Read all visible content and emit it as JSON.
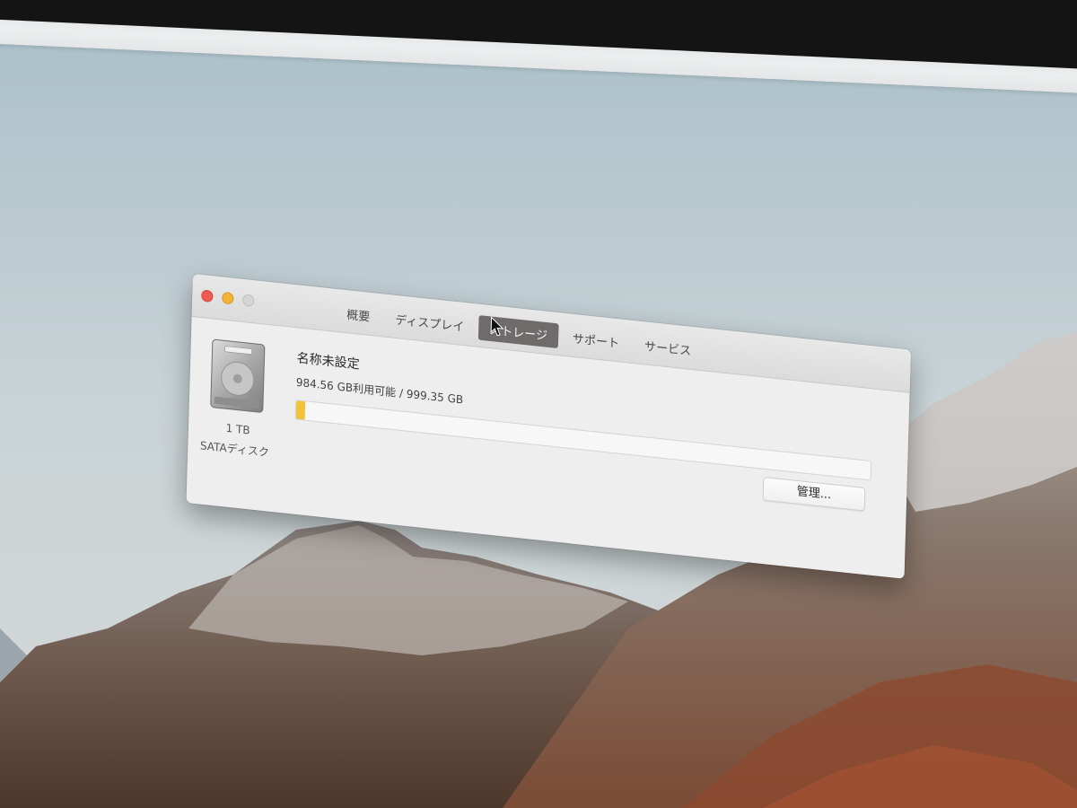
{
  "window": {
    "tabs": [
      {
        "label": "概要"
      },
      {
        "label": "ディスプレイ"
      },
      {
        "label": "ストレージ"
      },
      {
        "label": "サポート"
      },
      {
        "label": "サービス"
      }
    ],
    "active_tab_index": 2
  },
  "storage": {
    "volume_name": "名称未設定",
    "capacity_text": "984.56 GB利用可能 / 999.35 GB",
    "used_fraction": 0.015,
    "bar_color": "#f2c33a",
    "disk_size": "1 TB",
    "disk_type": "SATAディスク",
    "manage_button_label": "管理..."
  },
  "traffic_lights": {
    "close_color": "#ee5a52",
    "minimize_color": "#f2b53a",
    "zoom_color": "#d6d4d4"
  },
  "icons": {
    "disk": "hard-disk-icon",
    "pointer": "mouse-pointer-icon"
  }
}
